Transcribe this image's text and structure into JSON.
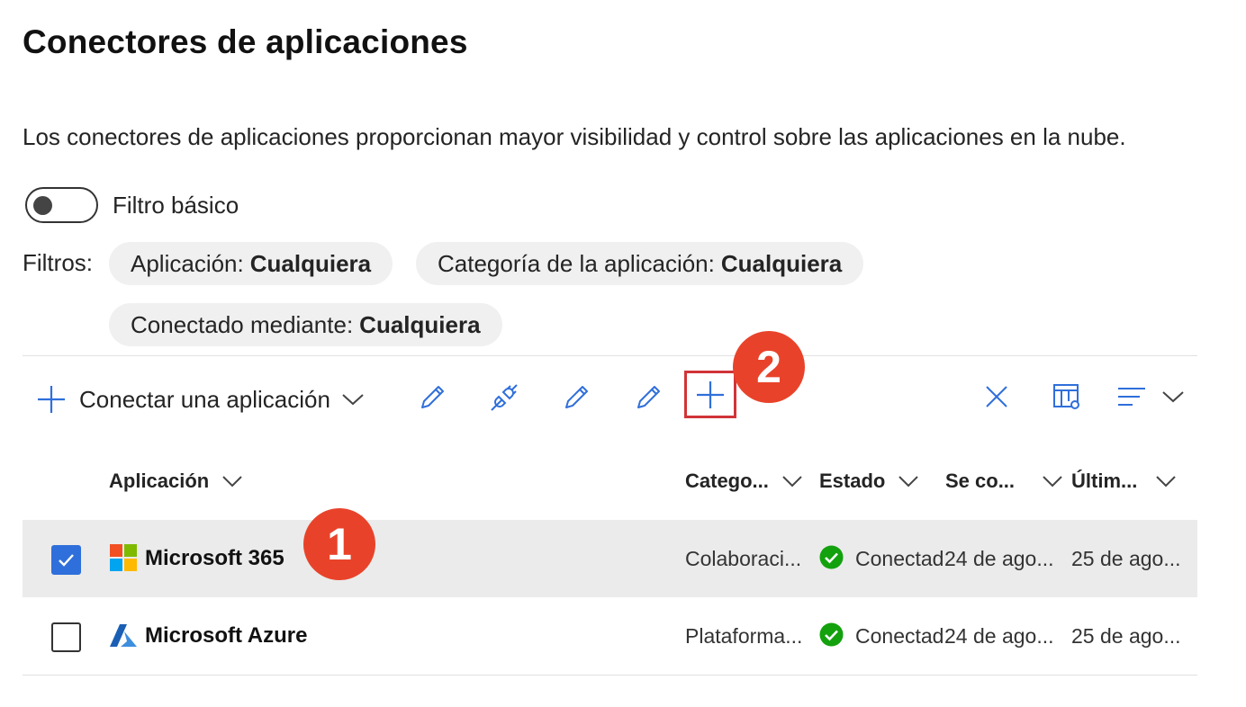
{
  "page": {
    "title": "Conectores de aplicaciones",
    "description": "Los conectores de aplicaciones proporcionan mayor visibilidad y control sobre las aplicaciones en la nube."
  },
  "toggle": {
    "label": "Filtro básico",
    "on": false
  },
  "filters": {
    "label": "Filtros:",
    "pills": [
      {
        "name": "Aplicación:",
        "value": "Cualquiera"
      },
      {
        "name": "Categoría de la aplicación:",
        "value": "Cualquiera"
      },
      {
        "name": "Conectado mediante:",
        "value": "Cualquiera"
      }
    ]
  },
  "toolbar": {
    "connect_label": "Conectar una aplicación",
    "icons": [
      "add-icon",
      "chevron-down-icon",
      "edit-icon",
      "plug-icon",
      "edit-icon",
      "edit-icon",
      "add-icon",
      "close-icon",
      "column-settings-icon",
      "group-list-icon",
      "chevron-down-icon"
    ]
  },
  "annotations": {
    "badge1": "1",
    "badge2": "2"
  },
  "table": {
    "columns": [
      "Aplicación",
      "Catego...",
      "Estado",
      "Se co...",
      "Últim..."
    ],
    "rows": [
      {
        "selected": true,
        "app": "Microsoft 365",
        "logo": "microsoft-365-logo",
        "category": "Colaboraci...",
        "status": "Conectad",
        "connected": "24 de ago...",
        "last": "25 de ago..."
      },
      {
        "selected": false,
        "app": "Microsoft Azure",
        "logo": "microsoft-azure-logo",
        "category": "Plataforma...",
        "status": "Conectad",
        "connected": "24 de ago...",
        "last": "25 de ago..."
      }
    ]
  },
  "colors": {
    "accent": "#2f6fdb",
    "badge": "#e8432a",
    "highlight": "#d13438",
    "success": "#13a10e",
    "selected_row": "#ebebeb"
  }
}
